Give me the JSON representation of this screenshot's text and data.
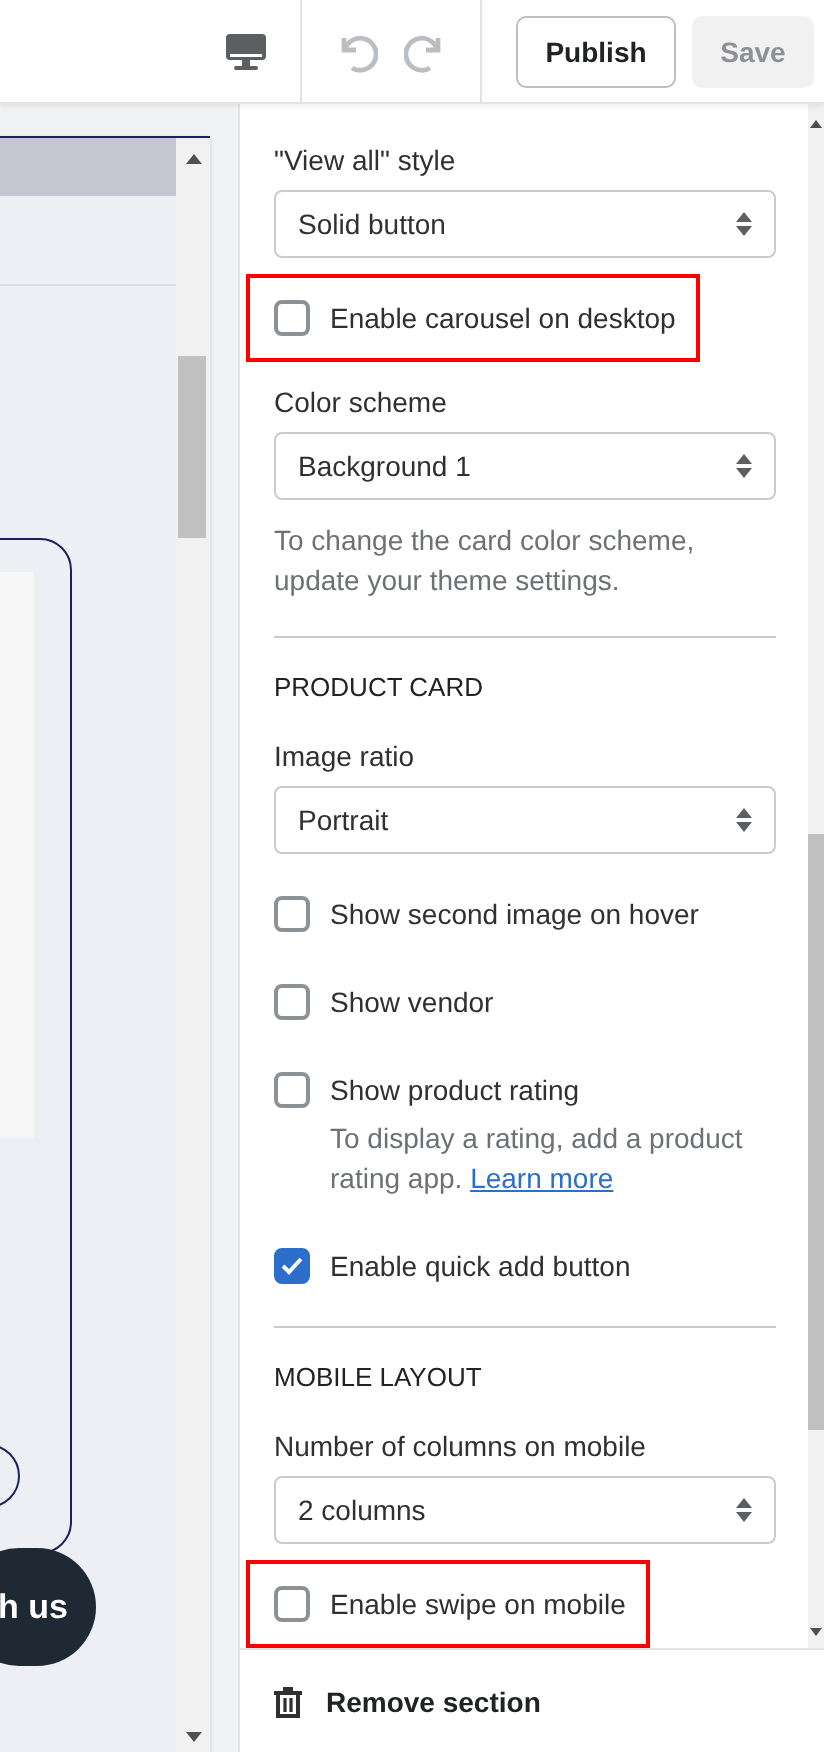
{
  "toolbar": {
    "publish": "Publish",
    "save": "Save",
    "save_disabled": true
  },
  "preview": {
    "button": "h us"
  },
  "panel": {
    "items": [
      {
        "kind": "select",
        "label": "\"View all\" style",
        "value": "Solid button"
      },
      {
        "kind": "checkbox",
        "label": "Enable carousel on desktop",
        "checked": false,
        "highlighted": true
      },
      {
        "kind": "select",
        "label": "Color scheme",
        "value": "Background 1",
        "help": "To change the card color scheme, update your theme settings."
      },
      {
        "kind": "divider"
      },
      {
        "kind": "heading",
        "label": "PRODUCT CARD"
      },
      {
        "kind": "select",
        "label": "Image ratio",
        "value": "Portrait"
      },
      {
        "kind": "checkbox",
        "label": "Show second image on hover",
        "checked": false,
        "highlighted": false
      },
      {
        "kind": "checkbox",
        "label": "Show vendor",
        "checked": false,
        "highlighted": false
      },
      {
        "kind": "checkbox",
        "label": "Show product rating",
        "checked": false,
        "highlighted": false,
        "help": "To display a rating, add a product rating app.",
        "link": "Learn more"
      },
      {
        "kind": "checkbox",
        "label": "Enable quick add button",
        "checked": true,
        "highlighted": false
      },
      {
        "kind": "divider"
      },
      {
        "kind": "heading",
        "label": "MOBILE LAYOUT"
      },
      {
        "kind": "select",
        "label": "Number of columns on mobile",
        "value": "2 columns"
      },
      {
        "kind": "checkbox",
        "label": "Enable swipe on mobile",
        "checked": false,
        "highlighted": true
      }
    ]
  },
  "footer": {
    "remove": "Remove section"
  }
}
